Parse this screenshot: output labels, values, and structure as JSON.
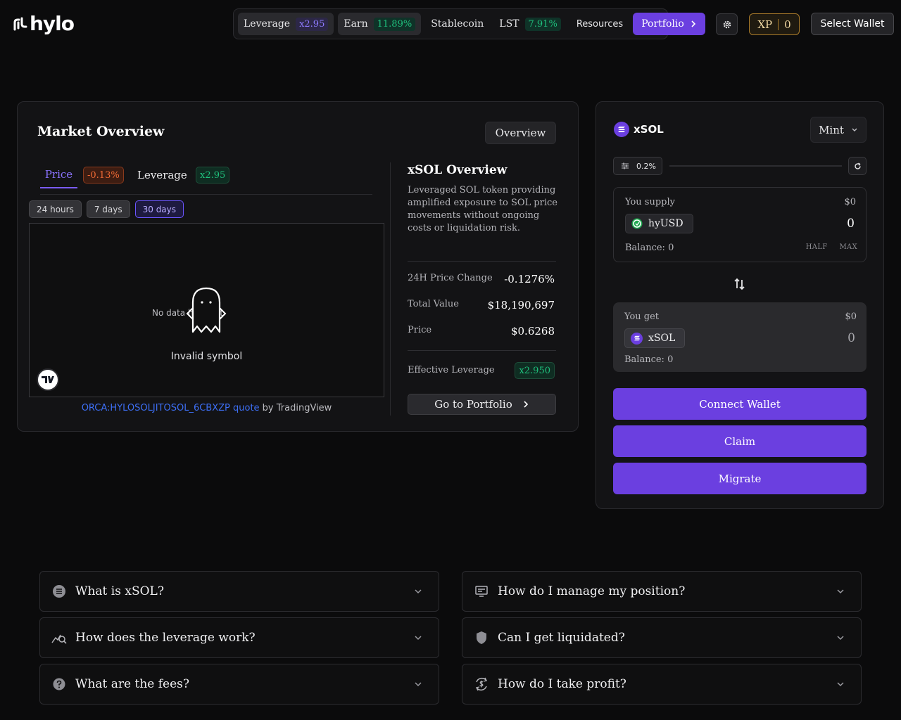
{
  "brand": {
    "name": "hylo"
  },
  "nav": {
    "leverage": {
      "label": "Leverage",
      "badge": "x2.95"
    },
    "earn": {
      "label": "Earn",
      "badge": "11.89%"
    },
    "stablecoin": {
      "label": "Stablecoin"
    },
    "lst": {
      "label": "LST",
      "badge": "7.91%"
    },
    "resources": {
      "label": "Resources"
    },
    "portfolio": {
      "label": "Portfolio"
    }
  },
  "header": {
    "xp_label": "XP",
    "xp_value": "0",
    "select_wallet": "Select Wallet"
  },
  "market": {
    "title": "Market Overview",
    "overview_button": "Overview",
    "tabs": {
      "price": {
        "label": "Price",
        "badge": "-0.13%"
      },
      "leverage": {
        "label": "Leverage",
        "badge": "x2.95"
      }
    },
    "ranges": [
      "24 hours",
      "7 days",
      "30 days"
    ],
    "active_range": "30 days",
    "chart": {
      "no_data": "No data here yet",
      "invalid": "Invalid symbol",
      "attribution_link": "ORCA:HYLOSOLJITOSOL_6CBXZP quote",
      "attribution_suffix": " by TradingView"
    },
    "overview": {
      "title": "xSOL Overview",
      "description": "Leveraged SOL token providing amplified exposure to SOL price movements without ongoing costs or liquidation risk.",
      "stats": [
        {
          "label": "24H Price Change",
          "value": "-0.1276%"
        },
        {
          "label": "Total Value",
          "value": "$18,190,697"
        },
        {
          "label": "Price",
          "value": "$0.6268"
        }
      ],
      "effective_leverage_label": "Effective Leverage",
      "effective_leverage_value": "x2.950",
      "goto_portfolio": "Go to Portfolio"
    }
  },
  "swap": {
    "token": "xSOL",
    "mode": "Mint",
    "slippage": "0.2%",
    "supply": {
      "label": "You supply",
      "usd": "$0",
      "token": "hyUSD",
      "amount": "0",
      "balance": "Balance: 0",
      "half": "HALF",
      "max": "MAX"
    },
    "get": {
      "label": "You get",
      "usd": "$0",
      "token": "xSOL",
      "amount": "0",
      "balance": "Balance: 0"
    },
    "buttons": {
      "connect": "Connect Wallet",
      "claim": "Claim",
      "migrate": "Migrate"
    }
  },
  "faq": [
    {
      "q": "What is xSOL?",
      "icon": "coin-stack-icon"
    },
    {
      "q": "How do I manage my position?",
      "icon": "monitor-icon"
    },
    {
      "q": "How does the leverage work?",
      "icon": "chart-search-icon"
    },
    {
      "q": "Can I get liquidated?",
      "icon": "shield-icon"
    },
    {
      "q": "What are the fees?",
      "icon": "question-circle-icon"
    },
    {
      "q": "How do I take profit?",
      "icon": "dollar-cycle-icon"
    }
  ],
  "colors": {
    "accent": "#6b3fe0",
    "positive": "#1fbf7c",
    "negative": "#f06a35",
    "xp": "#a87a2a"
  }
}
